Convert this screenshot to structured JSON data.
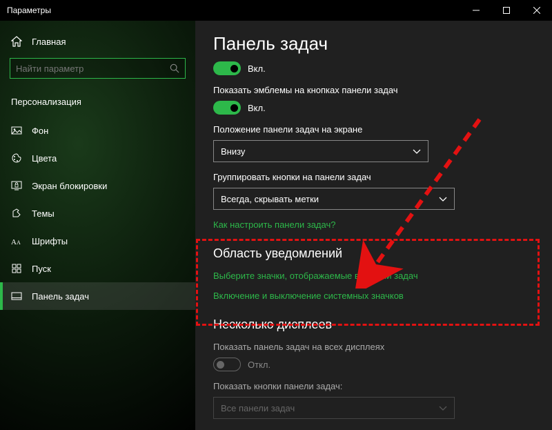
{
  "window": {
    "title": "Параметры"
  },
  "sidebar": {
    "home": "Главная",
    "search_placeholder": "Найти параметр",
    "section": "Персонализация",
    "items": [
      {
        "label": "Фон"
      },
      {
        "label": "Цвета"
      },
      {
        "label": "Экран блокировки"
      },
      {
        "label": "Темы"
      },
      {
        "label": "Шрифты"
      },
      {
        "label": "Пуск"
      },
      {
        "label": "Панель задач"
      }
    ]
  },
  "main": {
    "title": "Панель задач",
    "toggle1": {
      "state": "Вкл."
    },
    "badges": {
      "label": "Показать эмблемы на кнопках панели задач",
      "state": "Вкл."
    },
    "position": {
      "label": "Положение панели задач на экране",
      "value": "Внизу"
    },
    "grouping": {
      "label": "Группировать кнопки на панели задач",
      "value": "Всегда, скрывать метки"
    },
    "help_link": "Как настроить панели задач?",
    "notification_area": {
      "title": "Область уведомлений",
      "link1": "Выберите значки, отображаемые в панели задач",
      "link2": "Включение и выключение системных значков"
    },
    "multi_display": {
      "title": "Несколько дисплеев",
      "show_label": "Показать панель задач на всех дисплеях",
      "show_state": "Откл.",
      "buttons_label": "Показать кнопки панели задач:",
      "buttons_value": "Все панели задач"
    }
  }
}
